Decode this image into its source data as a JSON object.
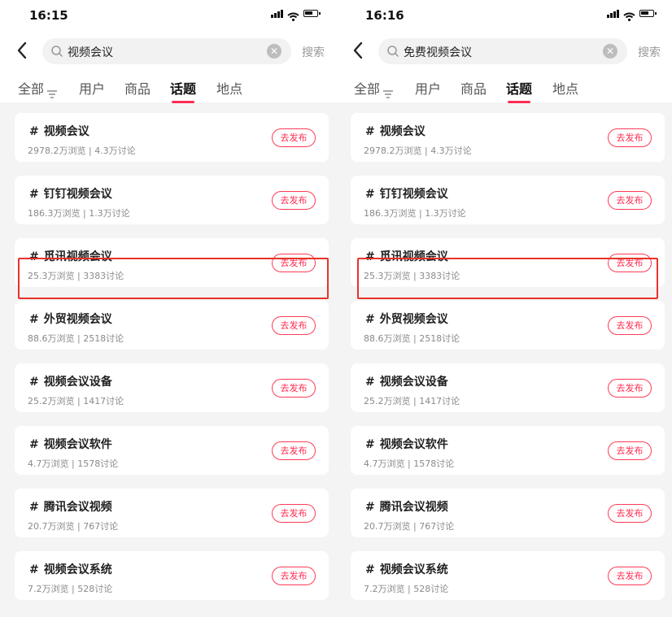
{
  "colors": {
    "accent": "#ff2c55",
    "highlight_box": "#e8322b",
    "meta_text": "#8a8a8a"
  },
  "icons": {
    "back": "chevron-left-icon",
    "search": "search-icon",
    "clear": "clear-circle-icon",
    "filter": "filter-icon",
    "signal": "signal-icon",
    "wifi": "wifi-icon",
    "battery": "battery-icon"
  },
  "panels": [
    {
      "status_time": "16:15",
      "search_query": "视频会议",
      "clear_glyph": "✕",
      "search_button": "搜索",
      "tabs": [
        {
          "label": "全部"
        },
        {
          "label": "用户"
        },
        {
          "label": "商品"
        },
        {
          "label": "话题",
          "active": true
        },
        {
          "label": "地点"
        }
      ],
      "items": [
        {
          "hash": "#",
          "title": "视频会议",
          "meta": "2978.2万浏览 | 4.3万讨论",
          "button": "去发布"
        },
        {
          "hash": "#",
          "title": "钉钉视频会议",
          "meta": "186.3万浏览 | 1.3万讨论",
          "button": "去发布"
        },
        {
          "hash": "#",
          "title": "觅讯视频会议",
          "meta": "25.3万浏览 | 3383讨论",
          "button": "去发布",
          "highlighted": true
        },
        {
          "hash": "#",
          "title": "外贸视频会议",
          "meta": "88.6万浏览 | 2518讨论",
          "button": "去发布"
        },
        {
          "hash": "#",
          "title": "视频会议设备",
          "meta": "25.2万浏览 | 1417讨论",
          "button": "去发布"
        },
        {
          "hash": "#",
          "title": "视频会议软件",
          "meta": "4.7万浏览 | 1578讨论",
          "button": "去发布"
        },
        {
          "hash": "#",
          "title": "腾讯会议视频",
          "meta": "20.7万浏览 | 767讨论",
          "button": "去发布"
        },
        {
          "hash": "#",
          "title": "视频会议系统",
          "meta": "7.2万浏览 | 528讨论",
          "button": "去发布"
        }
      ]
    },
    {
      "status_time": "16:16",
      "search_query": "免费视频会议",
      "clear_glyph": "✕",
      "search_button": "搜索",
      "tabs": [
        {
          "label": "全部"
        },
        {
          "label": "用户"
        },
        {
          "label": "商品"
        },
        {
          "label": "话题",
          "active": true
        },
        {
          "label": "地点"
        }
      ],
      "items": [
        {
          "hash": "#",
          "title": "视频会议",
          "meta": "2978.2万浏览 | 4.3万讨论",
          "button": "去发布"
        },
        {
          "hash": "#",
          "title": "钉钉视频会议",
          "meta": "186.3万浏览 | 1.3万讨论",
          "button": "去发布"
        },
        {
          "hash": "#",
          "title": "觅讯视频会议",
          "meta": "25.3万浏览 | 3383讨论",
          "button": "去发布",
          "highlighted": true
        },
        {
          "hash": "#",
          "title": "外贸视频会议",
          "meta": "88.6万浏览 | 2518讨论",
          "button": "去发布"
        },
        {
          "hash": "#",
          "title": "视频会议设备",
          "meta": "25.2万浏览 | 1417讨论",
          "button": "去发布"
        },
        {
          "hash": "#",
          "title": "视频会议软件",
          "meta": "4.7万浏览 | 1578讨论",
          "button": "去发布"
        },
        {
          "hash": "#",
          "title": "腾讯会议视频",
          "meta": "20.7万浏览 | 767讨论",
          "button": "去发布"
        },
        {
          "hash": "#",
          "title": "视频会议系统",
          "meta": "7.2万浏览 | 528讨论",
          "button": "去发布"
        }
      ]
    }
  ]
}
